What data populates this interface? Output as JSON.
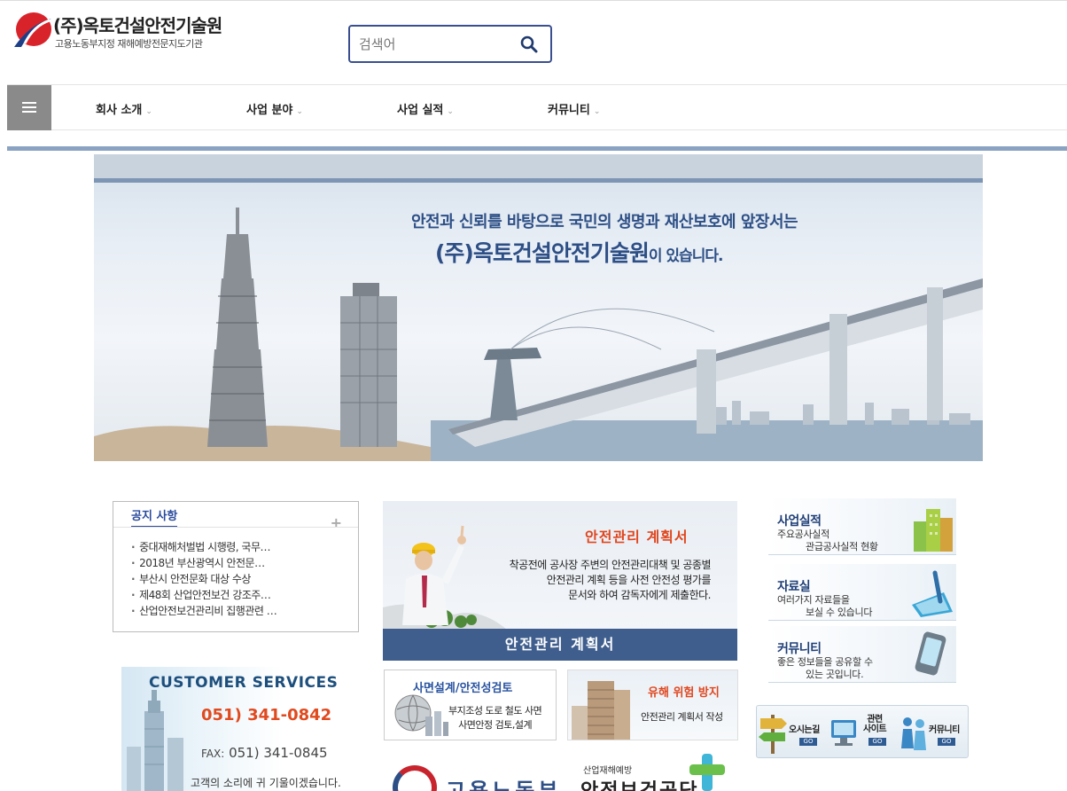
{
  "header": {
    "company_name": "(주)옥토건설안전기술원",
    "tagline": "고용노동부지정 재해예방전문지도기관",
    "search_placeholder": "검색어"
  },
  "nav": {
    "items": [
      {
        "label": "회사 소개"
      },
      {
        "label": "사업 분야"
      },
      {
        "label": "사업 실적"
      },
      {
        "label": "커뮤니티"
      }
    ],
    "chevron": "⌄"
  },
  "banner": {
    "line1": "안전과 신뢰를 바탕으로 국민의 생명과 재산보호에 앞장서는",
    "line2_main": "(주)옥토건설안전기술원",
    "line2_suffix": "이 있습니다."
  },
  "notice": {
    "title": "공지 사항",
    "plus": "+",
    "items": [
      "중대재해처벌법 시행령, 국무…",
      "2018년 부산광역시 안전문…",
      "부산시 안전문화 대상 수상",
      "제48회 산업안전보건 강조주…",
      "산업안전보건관리비 집행관련 …"
    ]
  },
  "customer": {
    "title": "CUSTOMER SERVICES",
    "phone": "051) 341-0842",
    "fax_label": "FAX:",
    "fax": "051) 341-0845",
    "voice": "고객의 소리에 귀 기울이겠습니다."
  },
  "plan": {
    "title": "안전관리 계획서",
    "desc_lines": [
      "착공전에 공사장 주변의 안전관리대책 및 공종별",
      "안전관리 계획 등을 사전 안전성 평가를",
      "문서와 하여 감독자에게 제출한다."
    ],
    "bar_label": "안전관리 계획서"
  },
  "cards": {
    "slope": {
      "title": "사면설계/안전성검토",
      "desc1": "부지조성 도로 철도 사면",
      "desc2": "사면안정 검토,설계"
    },
    "hazard": {
      "title": "유해 위험 방지",
      "desc": "안전관리 계획서 작성"
    }
  },
  "logos": {
    "moel": "고용노동부",
    "kosha_sub": "산업재해예방",
    "kosha": "안전보건공단"
  },
  "side": [
    {
      "title": "사업실적",
      "desc1": "주요공사실적",
      "desc2": "관급공사실적 현황"
    },
    {
      "title": "자료실",
      "desc1": "여러가지 자료들을",
      "desc2": "보실 수 있습니다"
    },
    {
      "title": "커뮤니티",
      "desc1": "좋은 정보들을 공유할 수",
      "desc2": "있는 곳입니다."
    }
  ],
  "quick": {
    "directions": "오시는길",
    "related1": "관련",
    "related2": "사이트",
    "community": "커뮤니티",
    "go": "GO"
  },
  "colors": {
    "brand_blue": "#2d4f86",
    "accent_red": "#e0461d",
    "nav_gray": "#8a8a8a",
    "bar_blue": "#3f5e8d"
  }
}
